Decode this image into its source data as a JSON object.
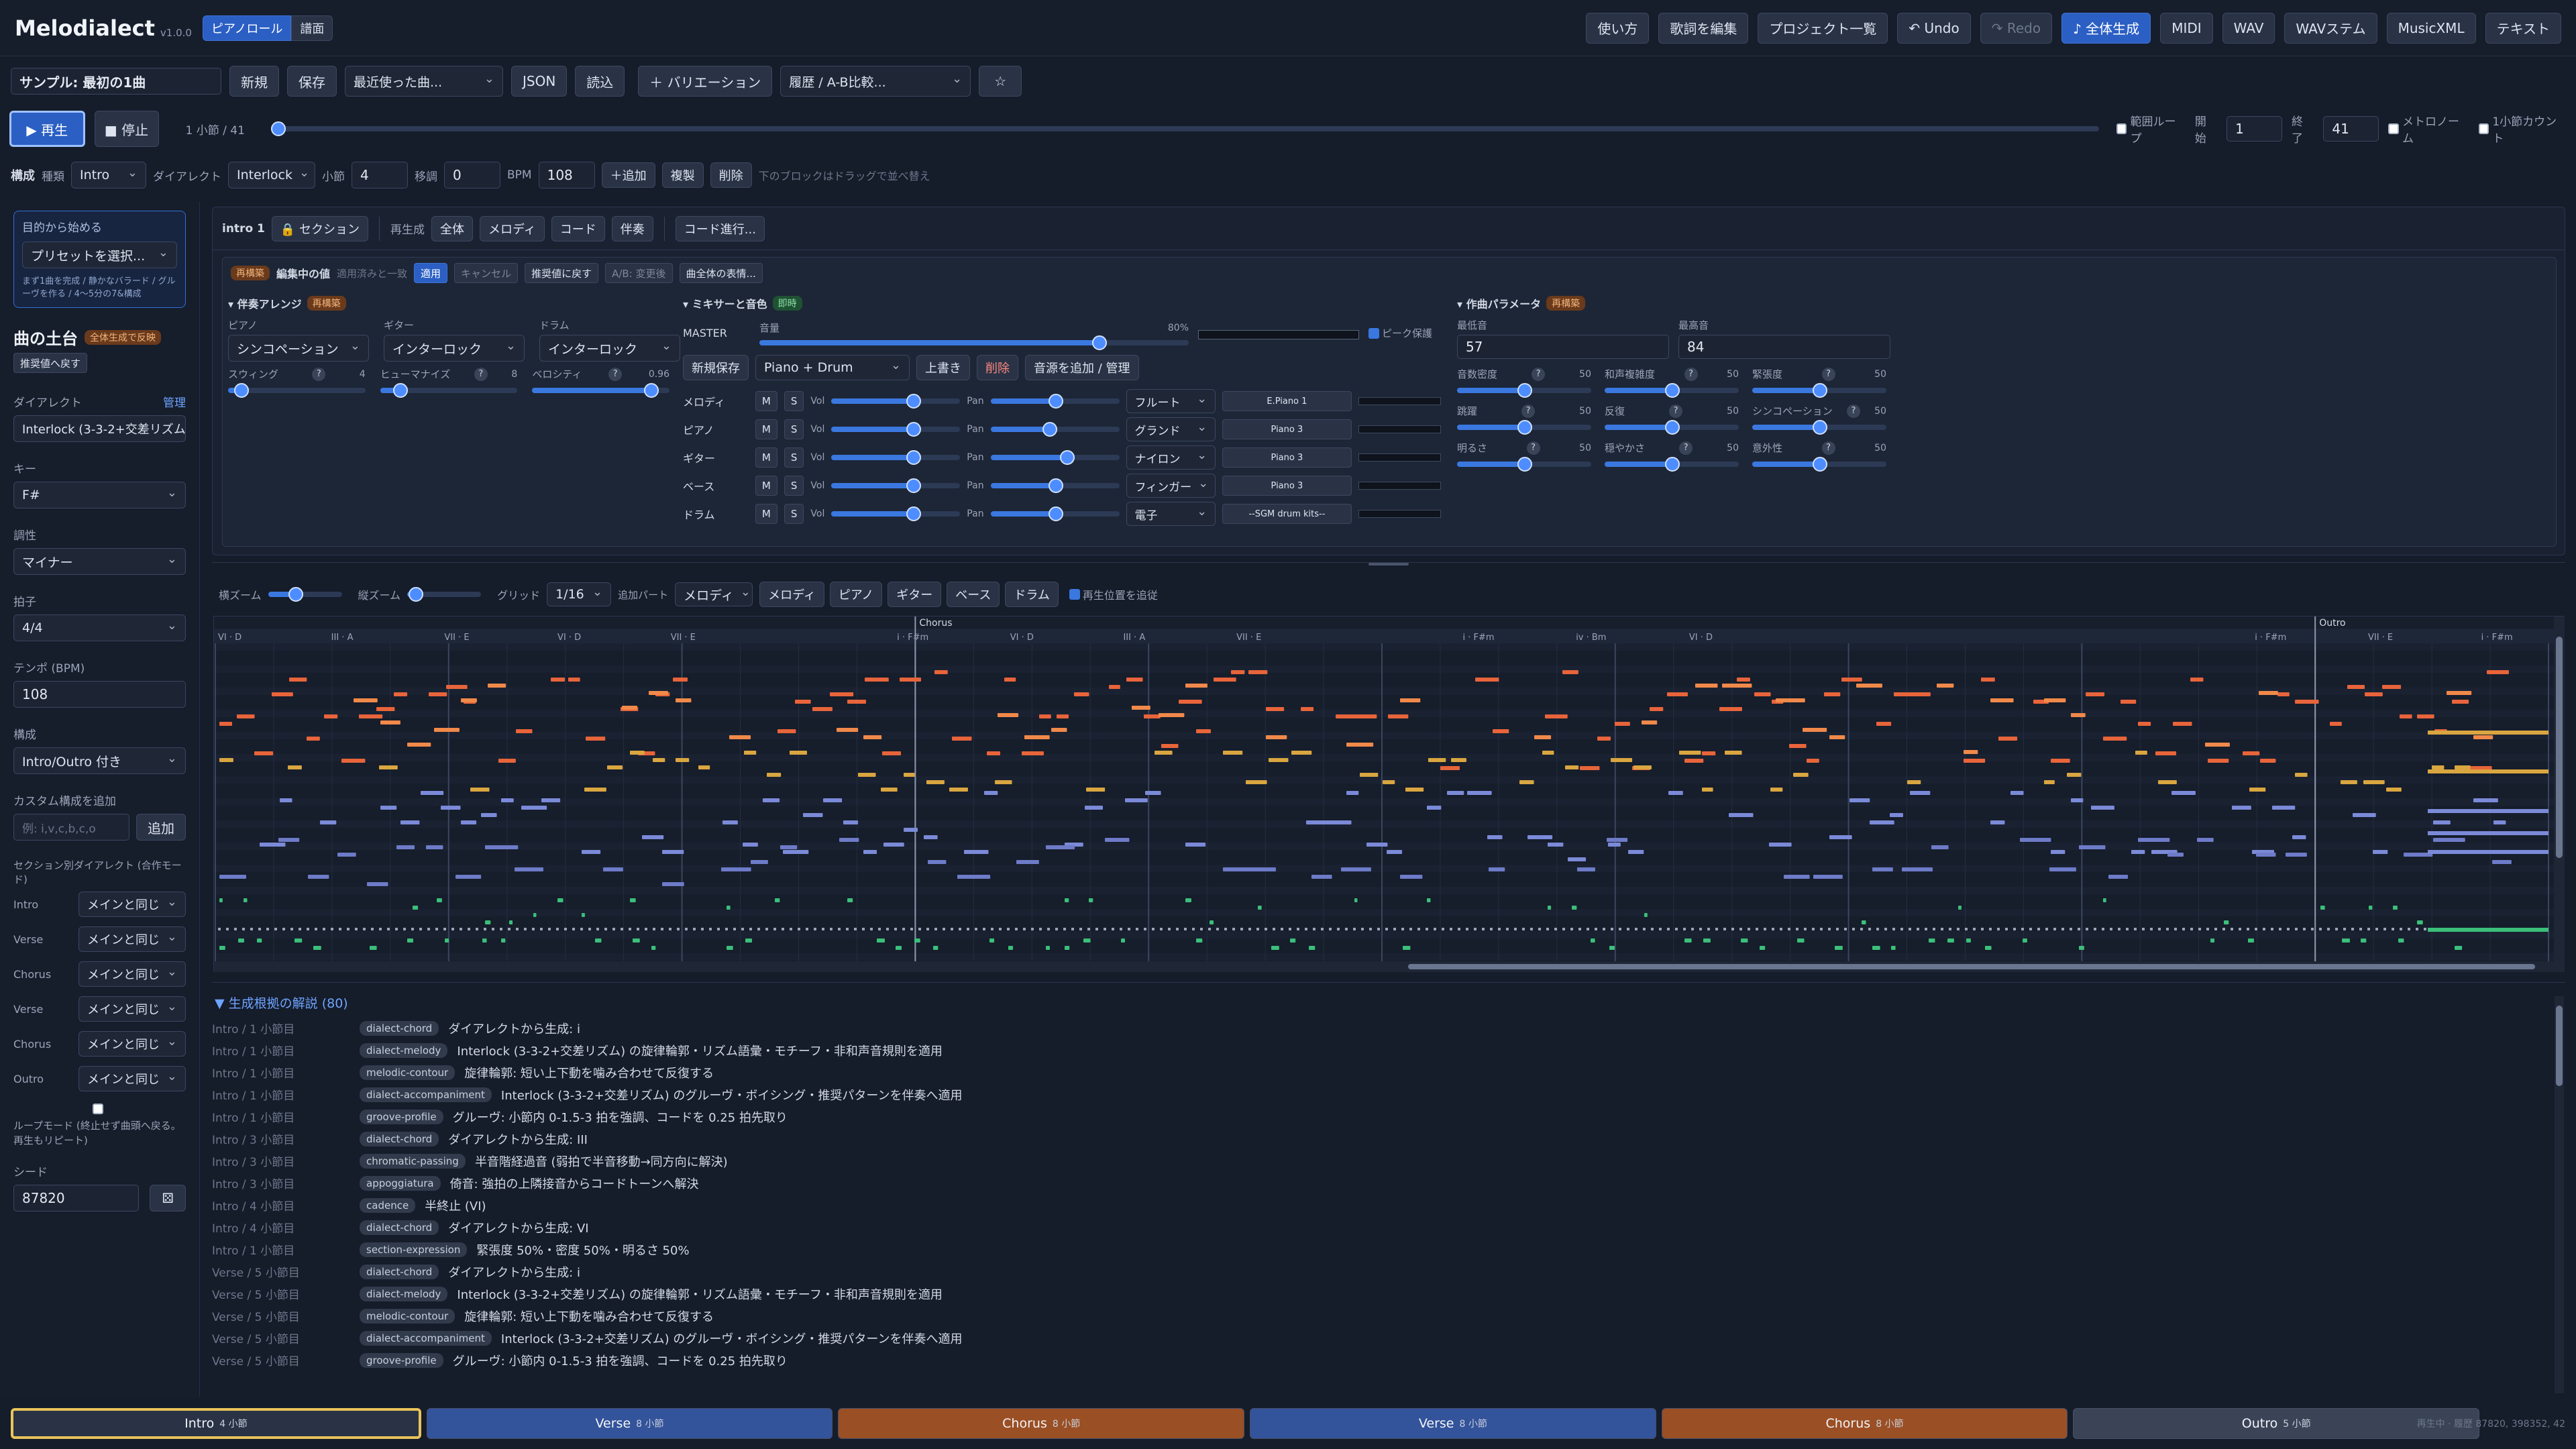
{
  "app": {
    "title": "Melodialect",
    "version": "v1.0.0",
    "mode_tabs": [
      "ピアノロール",
      "譜面"
    ]
  },
  "header_buttons": [
    "使い方",
    "歌詞を編集",
    "プロジェクト一覧",
    "↶ Undo",
    "↷ Redo",
    "♪ 全体生成",
    "MIDI",
    "WAV",
    "WAVステム",
    "MusicXML",
    "テキスト"
  ],
  "project": {
    "name": "サンプル: 最初の1曲",
    "buttons": [
      "新規",
      "保存"
    ],
    "recent": "最近使った曲...",
    "json": "JSON",
    "load": "読込",
    "variation": "＋ バリエーション",
    "history": "履歴 / A-B比較...",
    "star": "☆"
  },
  "transport": {
    "play": "▶ 再生",
    "stop": "■ 停止",
    "position": "1 小節 / 41",
    "range_loop": "範囲ループ",
    "start_label": "開始",
    "start": "1",
    "end_label": "終了",
    "end": "41",
    "metronome": "メトロノーム",
    "count_in": "1小節カウント",
    "progress": 0.0
  },
  "structure": {
    "title": "構成",
    "kind_label": "種類",
    "kind": "Intro",
    "dialect_label": "ダイアレクト",
    "dialect": "Interlock",
    "bars_label": "小節",
    "bars": "4",
    "transpose_label": "移調",
    "transpose": "0",
    "bpm_label": "BPM",
    "bpm": "108",
    "add": "＋追加",
    "dup": "複製",
    "del": "削除",
    "hint": "下のブロックはドラッグで並べ替え"
  },
  "sidebar": {
    "purpose_title": "目的から始める",
    "preset": "プリセットを選択...",
    "purpose_hint": "まず1曲を完成 / 静かなバラード / グルーヴを作る / 4〜5分の7&構成",
    "base_title": "曲の土台",
    "base_badge": "全体生成で反映",
    "reset": "推奨値へ戻す",
    "dialect_label": "ダイアレクト",
    "manage": "管理",
    "dialect": "Interlock (3-3-2+交差リズム)",
    "key_label": "キー",
    "key": "F#",
    "mode_label": "調性",
    "mode": "マイナー",
    "meter_label": "拍子",
    "meter": "4/4",
    "tempo_label": "テンポ (BPM)",
    "tempo": "108",
    "form_label": "構成",
    "form": "Intro/Outro 付き",
    "custom_label": "カスタム構成を追加",
    "custom_placeholder": "例: i,v,c,b,c,o",
    "custom_add": "追加",
    "section_dialect_label": "セクション別ダイアレクト (合作モード)",
    "sections": [
      {
        "name": "Intro",
        "value": "メインと同じ"
      },
      {
        "name": "Verse",
        "value": "メインと同じ"
      },
      {
        "name": "Chorus",
        "value": "メインと同じ"
      },
      {
        "name": "Verse",
        "value": "メインと同じ"
      },
      {
        "name": "Chorus",
        "value": "メインと同じ"
      },
      {
        "name": "Outro",
        "value": "メインと同じ"
      }
    ],
    "loop_mode": "ループモード (終止せず曲頭へ戻る。再生もリピート)",
    "seed_label": "シード",
    "seed": "87820"
  },
  "section_bar": {
    "name": "intro 1",
    "section": "🔒 セクション",
    "regen_label": "再生成",
    "regen": [
      "全体",
      "メロディ",
      "コード",
      "伴奏"
    ],
    "progress": "コード進行..."
  },
  "edit_bar": {
    "badge": "再構築",
    "editing": "編集中の値",
    "applied": "適用済みと一致",
    "apply": "適用",
    "cancel": "キャンセル",
    "reset": "推奨値に戻す",
    "ab": "A/B: 変更後",
    "expr": "曲全体の表情..."
  },
  "accomp": {
    "title": "▾ 伴奏アレンジ",
    "badge": "再構築",
    "piano_label": "ピアノ",
    "piano": "シンコペーション",
    "guitar_label": "ギター",
    "guitar": "インターロック",
    "drum_label": "ドラム",
    "drum": "インターロック",
    "swing_label": "スウィング",
    "swing": "4",
    "swing_v": 0.05,
    "humanize_label": "ヒューマナイズ",
    "humanize": "8",
    "humanize_v": 0.1,
    "velocity_label": "ベロシティ",
    "velocity": "0.96",
    "velocity_v": 0.9
  },
  "mixer": {
    "title": "▾ ミキサーと音色",
    "badge": "即時",
    "master": "MASTER",
    "vol_label": "音量",
    "vol_pct": "80%",
    "vol_v": 0.8,
    "peak": "ピーク保護",
    "save_new": "新規保存",
    "preset": "Piano + Drum",
    "overwrite": "上書き",
    "delete": "削除",
    "manage": "音源を追加 / 管理",
    "tracks": [
      {
        "name": "メロディ",
        "vol": 0.65,
        "pan": 0.5,
        "inst": "フルート",
        "sound": "E.Piano 1"
      },
      {
        "name": "ピアノ",
        "vol": 0.65,
        "pan": 0.45,
        "inst": "グランド",
        "sound": "Piano 3"
      },
      {
        "name": "ギター",
        "vol": 0.65,
        "pan": 0.6,
        "inst": "ナイロン",
        "sound": "Piano 3"
      },
      {
        "name": "ベース",
        "vol": 0.65,
        "pan": 0.5,
        "inst": "フィンガー",
        "sound": "Piano 3"
      },
      {
        "name": "ドラム",
        "vol": 0.65,
        "pan": 0.5,
        "inst": "電子",
        "sound": "--SGM drum kits--"
      }
    ],
    "m": "M",
    "s": "S",
    "vol": "Vol",
    "pan": "Pan"
  },
  "params": {
    "title": "▾ 作曲パラメータ",
    "badge": "再構築",
    "low_label": "最低音",
    "low": "57",
    "high_label": "最高音",
    "high": "84",
    "items": [
      {
        "label": "音数密度",
        "v": 50
      },
      {
        "label": "和声複雑度",
        "v": 50
      },
      {
        "label": "緊張度",
        "v": 50
      },
      {
        "label": "跳躍",
        "v": 50
      },
      {
        "label": "反復",
        "v": 50
      },
      {
        "label": "シンコペーション",
        "v": 50
      },
      {
        "label": "明るさ",
        "v": 50
      },
      {
        "label": "穏やかさ",
        "v": 50
      },
      {
        "label": "意外性",
        "v": 50
      }
    ]
  },
  "roll_toolbar": {
    "hzoom": "横ズーム",
    "vzoom": "縦ズーム",
    "grid_label": "グリッド",
    "grid": "1/16",
    "add_part_label": "追加パート",
    "add_part": "メロディ",
    "parts": [
      "メロディ",
      "ピアノ",
      "ギター",
      "ベース",
      "ドラム"
    ],
    "follow": "再生位置を追従"
  },
  "roll": {
    "sections": [
      {
        "name": "Chorus",
        "bar": 13
      },
      {
        "name": "Outro",
        "bar": 37
      }
    ],
    "total_bars": 41,
    "chords": [
      "VI · D",
      "III · A",
      "VII · E",
      "VI · D",
      "VII · E",
      "i · F#m",
      "VI · D",
      "III · A",
      "VII · E",
      "i · F#m",
      "iv · Bm",
      "VI · D",
      "i · F#m",
      "VII · E",
      "i · F#m",
      "i · F#m"
    ],
    "chord_bars": [
      1,
      3,
      5,
      7,
      9,
      13,
      15,
      17,
      19,
      23,
      25,
      27,
      37,
      39,
      41,
      43
    ]
  },
  "log": {
    "title": "▼ 生成根拠の解説 (80)",
    "entries": [
      {
        "pos": "Intro / 1 小節目",
        "tag": "dialect-chord",
        "text": "ダイアレクトから生成: i"
      },
      {
        "pos": "Intro / 1 小節目",
        "tag": "dialect-melody",
        "text": "Interlock (3-3-2+交差リズム) の旋律輪郭・リズム語彙・モチーフ・非和声音規則を適用"
      },
      {
        "pos": "Intro / 1 小節目",
        "tag": "melodic-contour",
        "text": "旋律輪郭: 短い上下動を噛み合わせて反復する"
      },
      {
        "pos": "Intro / 1 小節目",
        "tag": "dialect-accompaniment",
        "text": "Interlock (3-3-2+交差リズム) のグルーヴ・ボイシング・推奨パターンを伴奏へ適用"
      },
      {
        "pos": "Intro / 1 小節目",
        "tag": "groove-profile",
        "text": "グルーヴ: 小節内 0-1.5-3 拍を強調、コードを 0.25 拍先取り"
      },
      {
        "pos": "Intro / 3 小節目",
        "tag": "dialect-chord",
        "text": "ダイアレクトから生成: III"
      },
      {
        "pos": "Intro / 3 小節目",
        "tag": "chromatic-passing",
        "text": "半音階経過音 (弱拍で半音移動→同方向に解決)"
      },
      {
        "pos": "Intro / 3 小節目",
        "tag": "appoggiatura",
        "text": "倚音: 強拍の上隣接音からコードトーンへ解決"
      },
      {
        "pos": "Intro / 4 小節目",
        "tag": "cadence",
        "text": "半終止 (VI)"
      },
      {
        "pos": "Intro / 4 小節目",
        "tag": "dialect-chord",
        "text": "ダイアレクトから生成: VI"
      },
      {
        "pos": "Intro / 1 小節目",
        "tag": "section-expression",
        "text": "緊張度 50%・密度 50%・明るさ 50%"
      },
      {
        "pos": "Verse / 5 小節目",
        "tag": "dialect-chord",
        "text": "ダイアレクトから生成: i"
      },
      {
        "pos": "Verse / 5 小節目",
        "tag": "dialect-melody",
        "text": "Interlock (3-3-2+交差リズム) の旋律輪郭・リズム語彙・モチーフ・非和声音規則を適用"
      },
      {
        "pos": "Verse / 5 小節目",
        "tag": "melodic-contour",
        "text": "旋律輪郭: 短い上下動を噛み合わせて反復する"
      },
      {
        "pos": "Verse / 5 小節目",
        "tag": "dialect-accompaniment",
        "text": "Interlock (3-3-2+交差リズム) のグルーヴ・ボイシング・推奨パターンを伴奏へ適用"
      },
      {
        "pos": "Verse / 5 小節目",
        "tag": "groove-profile",
        "text": "グルーヴ: 小節内 0-1.5-3 拍を強調、コードを 0.25 拍先取り"
      }
    ]
  },
  "blocks": [
    {
      "name": "Intro",
      "bars": "4 小節",
      "color": "#2a3346",
      "border": "#e8c45a"
    },
    {
      "name": "Verse",
      "bars": "8 小節",
      "color": "#33539a"
    },
    {
      "name": "Chorus",
      "bars": "8 小節",
      "color": "#9b4f24"
    },
    {
      "name": "Verse",
      "bars": "8 小節",
      "color": "#33539a"
    },
    {
      "name": "Chorus",
      "bars": "8 小節",
      "color": "#9b4f24"
    },
    {
      "name": "Outro",
      "bars": "5 小節",
      "color": "#3b4457"
    }
  ],
  "status": "再生中 · 履歴 87820, 398352, 42",
  "colors": {
    "melody": "#e8643a",
    "melody2": "#f0894a",
    "piano": "#7b8ad8",
    "guitar": "#d9a640",
    "bass": "#6d7bc8",
    "drum": "#3bbf7a"
  }
}
